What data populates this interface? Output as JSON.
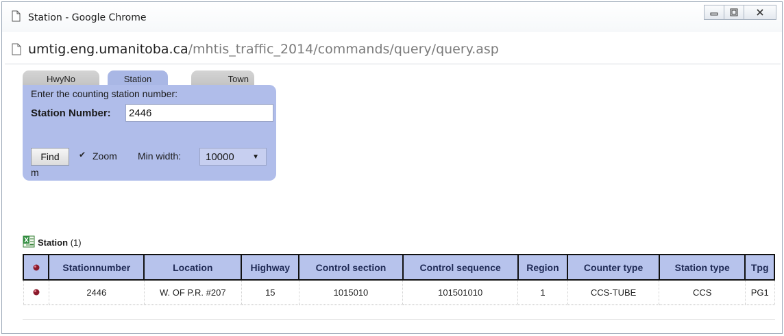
{
  "window": {
    "title": "Station - Google Chrome",
    "controls": [
      "minimize",
      "maximize",
      "close"
    ]
  },
  "address": {
    "host": "umtig.eng.umanitoba.ca",
    "path": "/mhtis_traffic_2014/commands/query/query.asp"
  },
  "tabs": [
    {
      "label": "HwyNo",
      "active": false
    },
    {
      "label": "Station",
      "active": true
    },
    {
      "label": "Town",
      "active": false
    }
  ],
  "form": {
    "prompt": "Enter the counting station number:",
    "station_label": "Station Number:",
    "station_value": "2446",
    "find_label": "Find",
    "zoom_checked": true,
    "zoom_label": "Zoom",
    "min_width_label": "Min width:",
    "min_width_value": "10000",
    "unit": "m"
  },
  "results": {
    "title": "Station",
    "count": "(1)",
    "columns": [
      "Stationnumber",
      "Location",
      "Highway",
      "Control section",
      "Control sequence",
      "Region",
      "Counter type",
      "Station type",
      "Tpg"
    ],
    "rows": [
      {
        "Stationnumber": "2446",
        "Location": "W. OF P.R. #207",
        "Highway": "15",
        "Control section": "1015010",
        "Control sequence": "101501010",
        "Region": "1",
        "Counter type": "CCS-TUBE",
        "Station type": "CCS",
        "Tpg": "PG1"
      }
    ]
  },
  "colors": {
    "panel": "#b0bdea",
    "header": "#b7c3ec",
    "marker": "#8b1a2b"
  },
  "icons": {
    "page": "page-icon",
    "excel": "excel-export-icon",
    "marker": "station-marker-icon"
  }
}
